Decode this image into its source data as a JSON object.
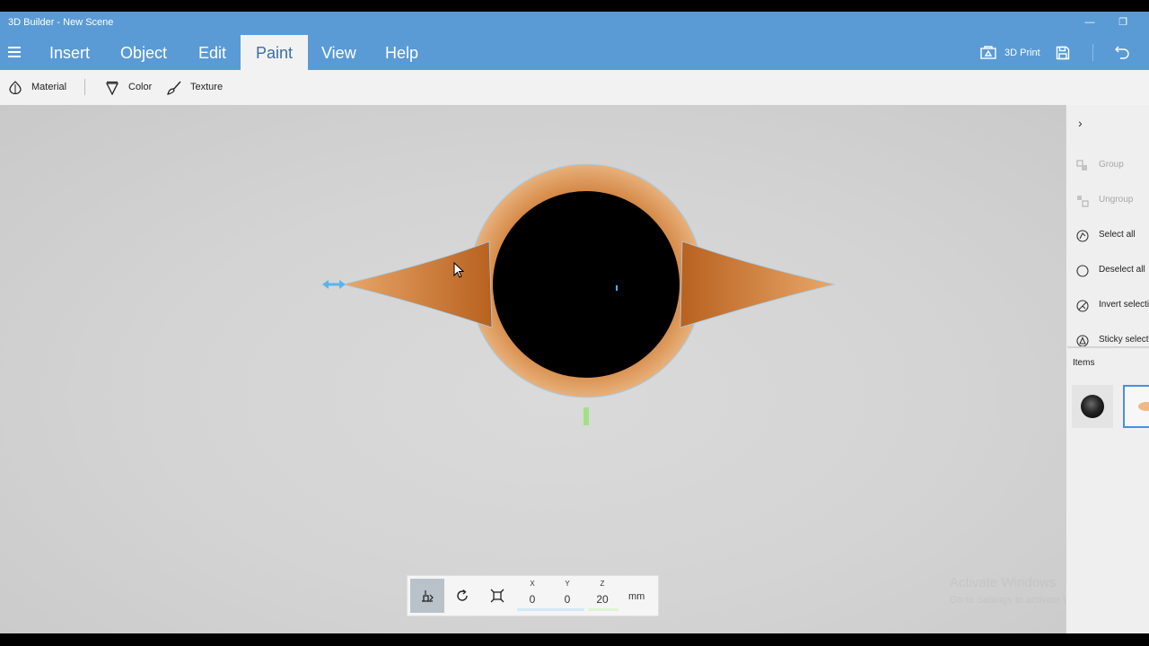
{
  "window": {
    "title": "3D Builder - New Scene",
    "minimize_glyph": "—",
    "restore_glyph": "❐"
  },
  "menu": {
    "tabs": [
      {
        "label": "Insert"
      },
      {
        "label": "Object"
      },
      {
        "label": "Edit"
      },
      {
        "label": "Paint",
        "active": true
      },
      {
        "label": "View"
      },
      {
        "label": "Help"
      }
    ],
    "print_label": "3D Print"
  },
  "toolbar": {
    "material_label": "Material",
    "color_label": "Color",
    "texture_label": "Texture"
  },
  "transform": {
    "x_label": "X",
    "x_value": "0",
    "y_label": "Y",
    "y_value": "0",
    "z_label": "Z",
    "z_value": "20",
    "unit": "mm"
  },
  "panel": {
    "chevron": "›",
    "actions": [
      {
        "label": "Group",
        "icon": "group-icon",
        "enabled": false
      },
      {
        "label": "Ungroup",
        "icon": "ungroup-icon",
        "enabled": false
      },
      {
        "label": "Select all",
        "icon": "select-all-icon",
        "enabled": true
      },
      {
        "label": "Deselect all",
        "icon": "deselect-all-icon",
        "enabled": true
      },
      {
        "label": "Invert selection",
        "icon": "invert-selection-icon",
        "enabled": true
      },
      {
        "label": "Sticky selection",
        "icon": "sticky-selection-icon",
        "enabled": true
      }
    ],
    "items_label": "Items"
  },
  "watermark": {
    "line1": "Activate Windows",
    "line2": "Go to Settings to activate Windows."
  },
  "colors": {
    "accent": "#5a9bd5",
    "accent_dark": "#3a6fa8",
    "ring_orange": "#d9893c",
    "selection_blue": "#6ab6e8",
    "z_handle_green": "#9be07a"
  }
}
